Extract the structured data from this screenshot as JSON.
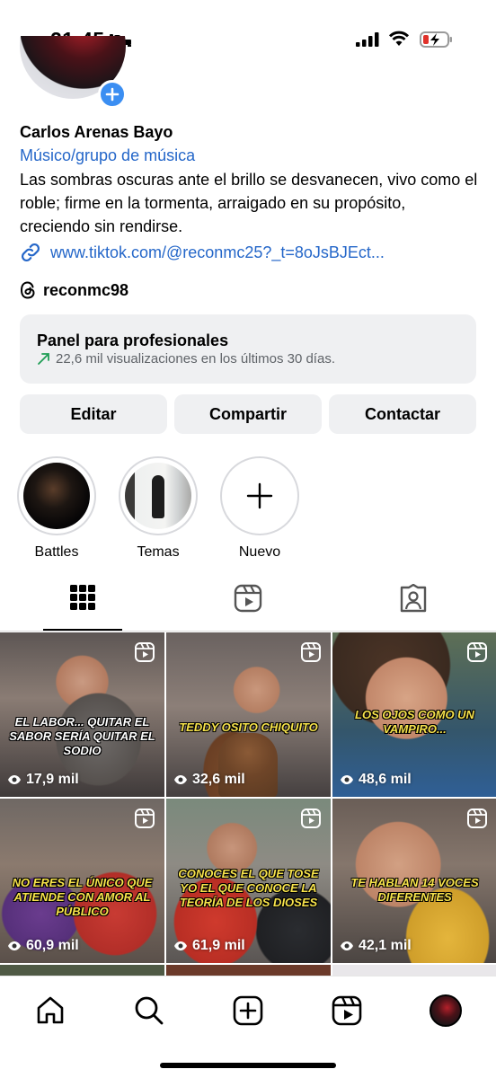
{
  "status_bar": {
    "time": "21:45"
  },
  "profile": {
    "name": "Carlos Arenas Bayo",
    "category": "Músico/grupo de música",
    "bio": "Las sombras oscuras ante el brillo se desvanecen, vivo como el roble; firme en la tormenta, arraigado en su propósito, creciendo sin rendirse.",
    "link": "www.tiktok.com/@reconmc25?_t=8oJsBJEct...",
    "threads_handle": "reconmc98"
  },
  "pro_panel": {
    "title": "Panel para profesionales",
    "stats": "22,6 mil visualizaciones en los últimos 30 días."
  },
  "actions": {
    "edit": "Editar",
    "share": "Compartir",
    "contact": "Contactar"
  },
  "highlights": [
    {
      "label": "Battles"
    },
    {
      "label": "Temas"
    },
    {
      "label": "Nuevo"
    }
  ],
  "tabs": {
    "active": "grid",
    "items": [
      "grid-icon",
      "reels-icon",
      "tagged-icon"
    ]
  },
  "posts": [
    {
      "caption": "EL LABOR... QUITAR EL SABOR SERÍA QUITAR EL SODIO",
      "views": "17,9 mil"
    },
    {
      "caption": "TEDDY OSITO CHIQUITO",
      "views": "32,6 mil"
    },
    {
      "caption": "LOS OJOS COMO UN VAMPIRO...",
      "views": "48,6 mil"
    },
    {
      "caption": "NO ERES EL ÚNICO QUE ATIENDE CON AMOR AL PÚBLICO",
      "views": "60,9 mil"
    },
    {
      "caption": "CONOCES EL QUE TOSE YO EL QUE CONOCE LA TEORÍA DE LOS DIOSES",
      "views": "61,9 mil"
    },
    {
      "caption": "TE HABLAN 14 VOCES DIFERENTES",
      "views": "42,1 mil"
    }
  ],
  "bottom_nav": [
    "home-icon",
    "search-icon",
    "create-icon",
    "reels-icon",
    "profile-avatar"
  ],
  "colors": {
    "link_blue": "#2567c9",
    "add_badge": "#3b8ef2",
    "panel_bg": "#eff0f2",
    "trend_green": "#1f9d55"
  }
}
